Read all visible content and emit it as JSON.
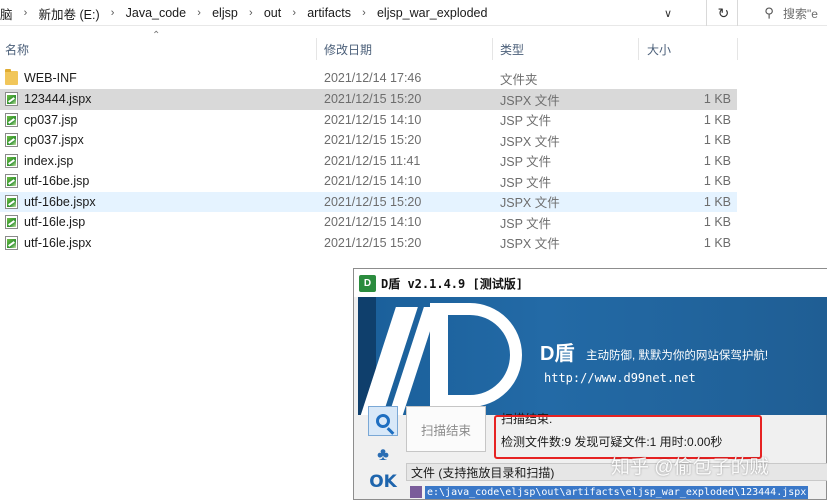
{
  "address_bar": {
    "crumbs": [
      "脑",
      "新加卷 (E:)",
      "Java_code",
      "eljsp",
      "out",
      "artifacts",
      "eljsp_war_exploded"
    ],
    "search_placeholder": "搜索\"e"
  },
  "columns": {
    "name": "名称",
    "modified": "修改日期",
    "type": "类型",
    "size": "大小"
  },
  "files": [
    {
      "name": "WEB-INF",
      "date": "2021/12/14 17:46",
      "type": "文件夹",
      "size": "",
      "icon": "folder-icon"
    },
    {
      "name": "123444.jspx",
      "date": "2021/12/15 15:20",
      "type": "JSPX 文件",
      "size": "1 KB",
      "icon": "jsp-file-icon"
    },
    {
      "name": "cp037.jsp",
      "date": "2021/12/15 14:10",
      "type": "JSP 文件",
      "size": "1 KB",
      "icon": "jsp-file-icon"
    },
    {
      "name": "cp037.jspx",
      "date": "2021/12/15 15:20",
      "type": "JSPX 文件",
      "size": "1 KB",
      "icon": "jsp-file-icon"
    },
    {
      "name": "index.jsp",
      "date": "2021/12/15 11:41",
      "type": "JSP 文件",
      "size": "1 KB",
      "icon": "jsp-file-icon"
    },
    {
      "name": "utf-16be.jsp",
      "date": "2021/12/15 14:10",
      "type": "JSP 文件",
      "size": "1 KB",
      "icon": "jsp-file-icon"
    },
    {
      "name": "utf-16be.jspx",
      "date": "2021/12/15 15:20",
      "type": "JSPX 文件",
      "size": "1 KB",
      "icon": "jsp-file-icon"
    },
    {
      "name": "utf-16le.jsp",
      "date": "2021/12/15 14:10",
      "type": "JSP 文件",
      "size": "1 KB",
      "icon": "jsp-file-icon"
    },
    {
      "name": "utf-16le.jspx",
      "date": "2021/12/15 15:20",
      "type": "JSPX 文件",
      "size": "1 KB",
      "icon": "jsp-file-icon"
    }
  ],
  "dshield": {
    "logo_text": "D",
    "title": "D盾 v2.1.4.9 [测试版]",
    "brand": "D盾",
    "slogan": "主动防御, 默默为你的网站保驾护航!",
    "url": "http://www.d99net.net",
    "scan_button": "扫描结束",
    "result_status": "扫描结束.",
    "result_stats": "检测文件数:9 发现可疑文件:1 用时:0.00秒",
    "list_header": "文件 (支持拖放目录和扫描)",
    "list_row": "e:\\java_code\\eljsp\\out\\artifacts\\eljsp_war_exploded\\123444.jspx",
    "ok_label": "OK"
  },
  "watermark": "知乎 @偷包子的贼"
}
